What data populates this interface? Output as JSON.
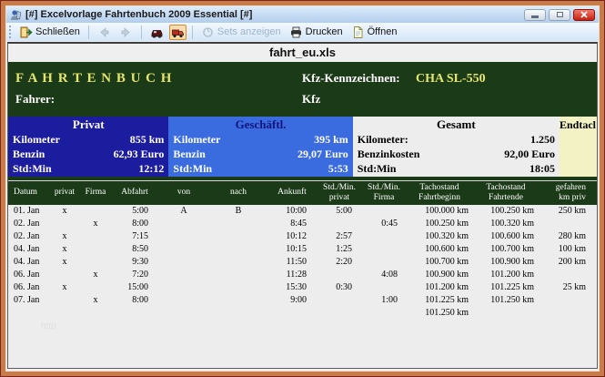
{
  "window": {
    "title": "[#] Excelvorlage Fahrtenbuch 2009 Essential [#]"
  },
  "toolbar": {
    "close_label": "Schließen",
    "sets_label": "Sets anzeigen",
    "print_label": "Drucken",
    "open_label": "Öffnen"
  },
  "doc": {
    "filename": "fahrt_eu.xls"
  },
  "sheet_header": {
    "title": "F A H R T E N B U C H",
    "plate_label": "Kfz-Kennzeichnen:",
    "plate_value": "CHA SL-550",
    "driver_label": "Fahrer:",
    "vehicle_label": "Kfz"
  },
  "summary": {
    "privat": {
      "title": "Privat",
      "rows": [
        {
          "label": "Kilometer",
          "value": "855 km"
        },
        {
          "label": "Benzin",
          "value": "62,93 Euro"
        },
        {
          "label": "Std:Min",
          "value": "12:12"
        }
      ]
    },
    "geschaeftl": {
      "title": "Geschäftl.",
      "rows": [
        {
          "label": "Kilometer",
          "value": "395 km"
        },
        {
          "label": "Benzin",
          "value": "29,07 Euro"
        },
        {
          "label": "Std:Min",
          "value": "5:53"
        }
      ]
    },
    "gesamt": {
      "title": "Gesamt",
      "rows": [
        {
          "label": "Kilometer:",
          "value": "1.250"
        },
        {
          "label": "Benzinkosten",
          "value": "92,00 Euro"
        },
        {
          "label": "Std:Min",
          "value": "18:05"
        }
      ]
    },
    "endtacho": {
      "title": "Endtacl"
    }
  },
  "table": {
    "headers": [
      "Datum",
      "privat",
      "Firma",
      "Abfahrt",
      "von",
      "nach",
      "Ankunft",
      "Std./Min.\nprivat",
      "Std./Min.\nFirma",
      "Tachostand\nFahrtbeginn",
      "Tachostand\nFahrtende",
      "gefahren\nkm priv"
    ],
    "rows": [
      [
        "01. Jan",
        "x",
        "",
        "5:00",
        "A",
        "B",
        "10:00",
        "5:00",
        "",
        "100.000 km",
        "100.250 km",
        "250 km"
      ],
      [
        "02. Jan",
        "",
        "x",
        "8:00",
        "",
        "",
        "8:45",
        "",
        "0:45",
        "100.250 km",
        "100.320 km",
        ""
      ],
      [
        "02. Jan",
        "x",
        "",
        "7:15",
        "",
        "",
        "10:12",
        "2:57",
        "",
        "100.320 km",
        "100.600 km",
        "280 km"
      ],
      [
        "04. Jan",
        "x",
        "",
        "8:50",
        "",
        "",
        "10:15",
        "1:25",
        "",
        "100.600 km",
        "100.700 km",
        "100 km"
      ],
      [
        "04. Jan",
        "x",
        "",
        "9:30",
        "",
        "",
        "11:50",
        "2:20",
        "",
        "100.700 km",
        "100.900 km",
        "200 km"
      ],
      [
        "06. Jan",
        "",
        "x",
        "7:20",
        "",
        "",
        "11:28",
        "",
        "4:08",
        "100.900 km",
        "101.200 km",
        ""
      ],
      [
        "06. Jan",
        "x",
        "",
        "15:00",
        "",
        "",
        "15:30",
        "0:30",
        "",
        "101.200 km",
        "101.225 km",
        "25 km"
      ],
      [
        "07. Jan",
        "",
        "x",
        "8:00",
        "",
        "",
        "9:00",
        "",
        "1:00",
        "101.225 km",
        "101.250 km",
        ""
      ],
      [
        "",
        "",
        "",
        "",
        "",
        "",
        "",
        "",
        "",
        "101.250 km",
        "",
        ""
      ]
    ]
  },
  "watermark": "http",
  "colors": {
    "frame_orange": "#c87c4a",
    "dark_green": "#1b3a17",
    "privat_blue": "#1c1c9e",
    "business_blue": "#3a6ce0",
    "accent_yellow": "#e6e66e",
    "endtacho_bg": "#f2f2c4",
    "close_red": "#c61f12"
  }
}
